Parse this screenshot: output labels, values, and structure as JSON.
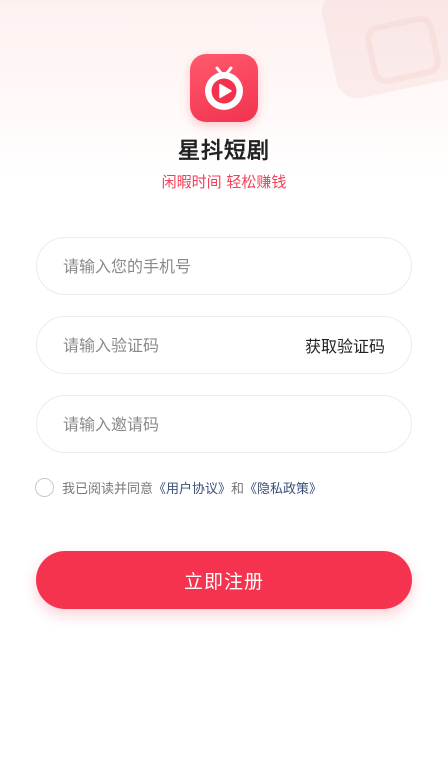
{
  "app": {
    "name": "星抖短剧",
    "slogan": "闲暇时间 轻松赚钱",
    "logo_icon": "tv-play-icon"
  },
  "form": {
    "phone_placeholder": "请输入您的手机号",
    "code_placeholder": "请输入验证码",
    "get_code_label": "获取验证码",
    "invite_placeholder": "请输入邀请码"
  },
  "agreement": {
    "prefix": "我已阅读并同意",
    "user_agreement": "《用户协议》",
    "and": "和",
    "privacy_policy": "《隐私政策》"
  },
  "submit_label": "立即注册",
  "colors": {
    "accent": "#f5334e",
    "slogan": "#f0415a",
    "link": "#3a4d7a"
  }
}
